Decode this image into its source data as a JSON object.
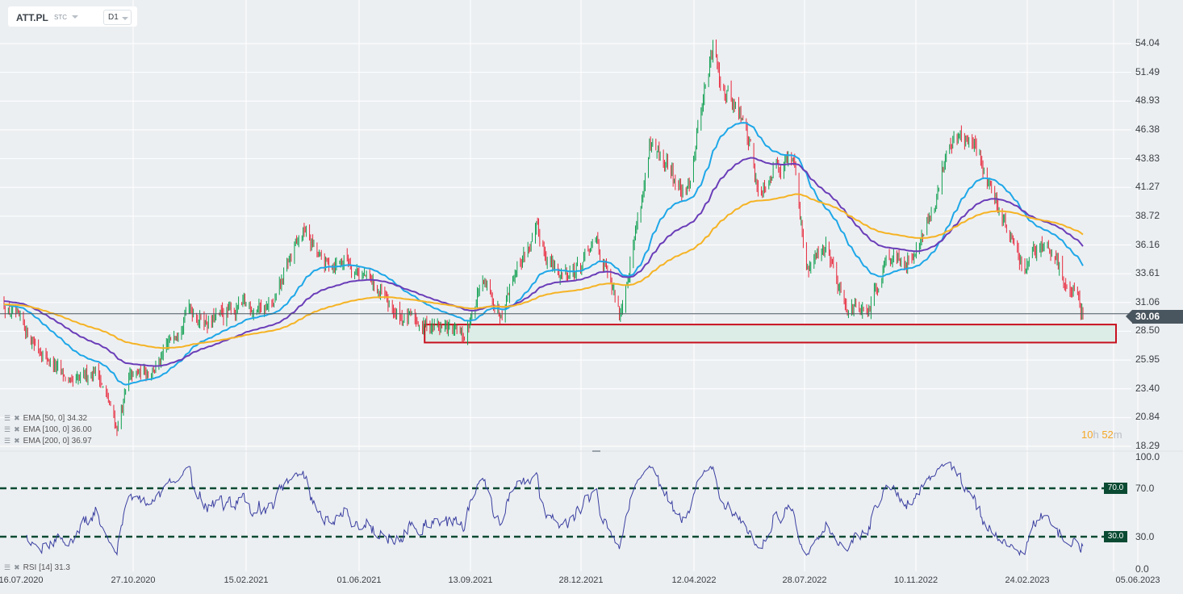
{
  "header": {
    "symbol": "ATT.PL",
    "market": "STC",
    "timeframe": "D1"
  },
  "indicators": [
    {
      "label": "EMA [50,  0] 34.32",
      "color": "#1ea7e8"
    },
    {
      "label": "EMA [100,  0] 36.00",
      "color": "#6a3db8"
    },
    {
      "label": "EMA [200,  0] 36.97",
      "color": "#f5b324"
    }
  ],
  "rsi_legend": "RSI [14] 31.3",
  "countdown": {
    "hours": "10",
    "h": "h",
    "minutes": "52",
    "m": "m"
  },
  "current_price": "30.06",
  "colors": {
    "up": "#0e9f4f",
    "down": "#e8283c",
    "zone_border": "#c8101e",
    "zone_fill": "#dcece6",
    "rsi_line": "#3a3fa0",
    "rsi_level": "#0a4a32"
  },
  "chart_data": [
    {
      "type": "candlestick",
      "title": "ATT.PL D1",
      "x_unit": "days since 16.07.2020",
      "xlim": [
        0,
        1054
      ],
      "ylim": [
        18.29,
        54.04
      ],
      "y_ticks": [
        "54.04",
        "51.49",
        "48.93",
        "46.38",
        "43.83",
        "41.27",
        "38.72",
        "36.16",
        "33.61",
        "31.06",
        "28.50",
        "25.95",
        "23.40",
        "20.84",
        "18.29"
      ],
      "x_ticks": [
        "16.07.2020",
        "27.10.2020",
        "15.02.2021",
        "01.06.2021",
        "13.09.2021",
        "28.12.2021",
        "12.04.2022",
        "28.07.2022",
        "10.11.2022",
        "24.02.2023",
        "05.06.2023"
      ],
      "close_path": {
        "day": [
          0,
          26,
          64,
          86,
          105,
          116,
          146,
          169,
          191,
          221,
          251,
          266,
          280,
          296,
          319,
          341,
          364,
          386,
          409,
          428,
          443,
          461,
          476,
          495,
          514,
          536,
          551,
          572,
          581,
          600,
          619,
          634,
          649,
          660,
          671,
          683,
          694,
          701,
          716,
          735,
          746,
          765,
          780,
          803,
          821,
          836,
          851,
          866,
          878,
          893,
          908,
          926,
          949,
          964,
          979,
          1003
        ],
        "price": [
          30.9,
          27.8,
          23.5,
          25.3,
          19.9,
          24.2,
          25.7,
          30.7,
          29.3,
          30.7,
          30.7,
          35.0,
          37.5,
          34.3,
          35.0,
          32.8,
          30.0,
          29.3,
          28.9,
          27.8,
          32.8,
          30.3,
          34.3,
          37.1,
          33.5,
          34.3,
          36.4,
          30.0,
          34.3,
          44.3,
          42.9,
          40.0,
          49.3,
          53.6,
          50.0,
          47.9,
          45.0,
          40.7,
          43.6,
          44.0,
          33.5,
          36.4,
          31.4,
          29.6,
          35.7,
          34.3,
          36.4,
          39.3,
          45.7,
          45.7,
          43.6,
          39.3,
          33.5,
          36.4,
          34.3,
          30.06
        ]
      },
      "series": [
        {
          "name": "EMA 50",
          "period": 50,
          "last": 34.32
        },
        {
          "name": "EMA 100",
          "period": 100,
          "last": 36.0
        },
        {
          "name": "EMA 200",
          "period": 200,
          "last": 36.97
        }
      ],
      "annotations": {
        "support_zone": [
          27.5,
          29.1
        ],
        "support_zone_start_day": 391,
        "current_price": 30.06
      }
    },
    {
      "type": "line",
      "title": "RSI [14]",
      "ylim": [
        0,
        100
      ],
      "y_ticks": [
        "100.0",
        "70.0",
        "30.0",
        "0.0"
      ],
      "levels": [
        "70.0",
        "30.0"
      ],
      "last": 31.3
    }
  ]
}
